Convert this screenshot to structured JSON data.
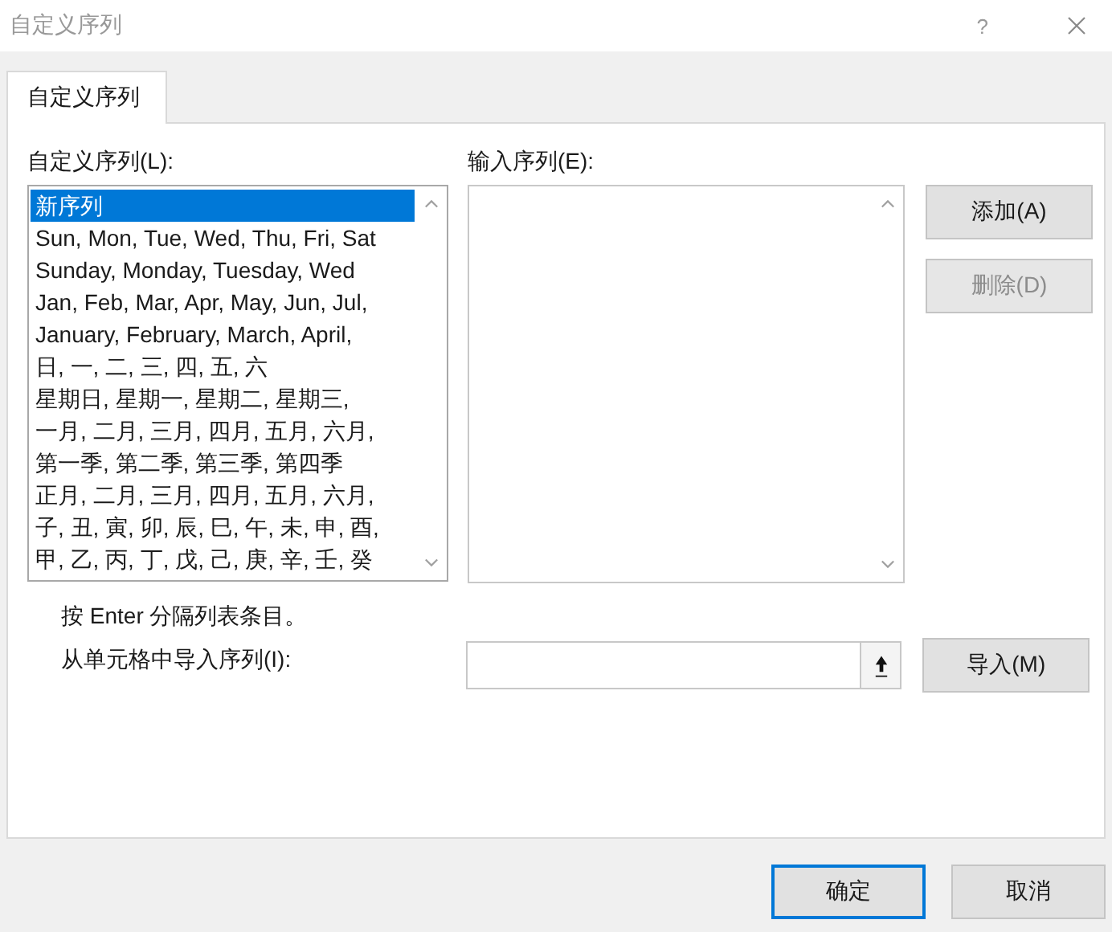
{
  "window": {
    "title": "自定义序列",
    "help": "?"
  },
  "tabs": [
    {
      "label": "自定义序列",
      "selected": true
    }
  ],
  "custom_lists": {
    "label": "自定义序列(L):",
    "items": [
      {
        "text": "新序列",
        "selected": true
      },
      {
        "text": "Sun, Mon, Tue, Wed, Thu, Fri, Sat",
        "selected": false
      },
      {
        "text": "Sunday, Monday, Tuesday, Wed",
        "selected": false
      },
      {
        "text": "Jan, Feb, Mar, Apr, May, Jun, Jul,",
        "selected": false
      },
      {
        "text": "January, February, March, April,",
        "selected": false
      },
      {
        "text": "日, 一, 二, 三, 四, 五, 六",
        "selected": false
      },
      {
        "text": "星期日, 星期一, 星期二, 星期三,",
        "selected": false
      },
      {
        "text": "一月, 二月, 三月, 四月, 五月, 六月,",
        "selected": false
      },
      {
        "text": "第一季, 第二季, 第三季, 第四季",
        "selected": false
      },
      {
        "text": "正月, 二月, 三月, 四月, 五月, 六月,",
        "selected": false
      },
      {
        "text": "子, 丑, 寅, 卯, 辰, 巳, 午, 未, 申, 酉,",
        "selected": false
      },
      {
        "text": "甲, 乙, 丙, 丁, 戊, 己, 庚, 辛, 壬, 癸",
        "selected": false
      }
    ]
  },
  "list_entries": {
    "label": "输入序列(E):"
  },
  "side_buttons": [
    {
      "label": "添加(A)",
      "disabled": false
    },
    {
      "label": "删除(D)",
      "disabled": true
    }
  ],
  "hint": "按 Enter 分隔列表条目。",
  "import": {
    "label": "从单元格中导入序列(I):",
    "button": "导入(M)"
  },
  "footer_buttons": [
    {
      "label": "确定",
      "default": true
    },
    {
      "label": "取消",
      "default": false
    }
  ]
}
